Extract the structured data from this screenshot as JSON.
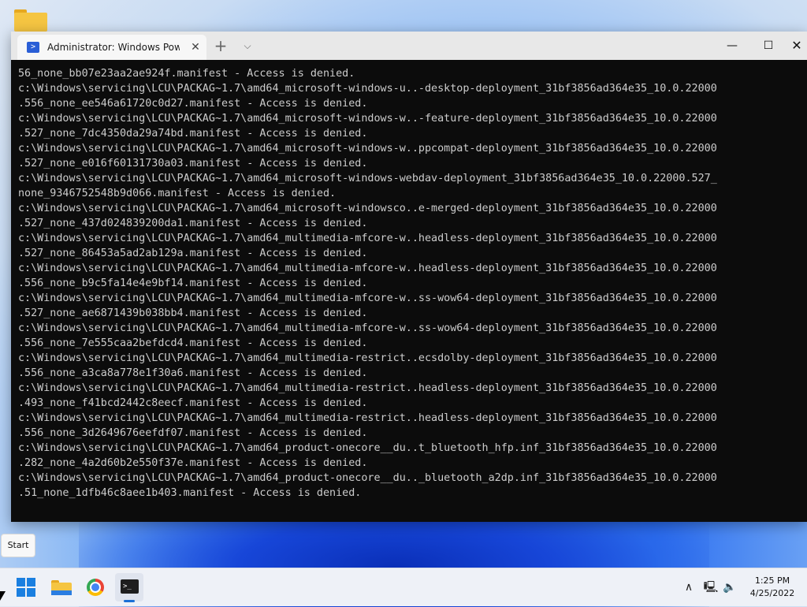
{
  "window": {
    "tab_title": "Administrator: Windows PowerShell",
    "new_tab": "+",
    "dropdown": "⌵",
    "minimize": "—",
    "maximize": "☐",
    "close": "✕"
  },
  "console_lines": [
    "56_none_bb07e23aa2ae924f.manifest - Access is denied.",
    "c:\\Windows\\servicing\\LCU\\PACKAG~1.7\\amd64_microsoft-windows-u..-desktop-deployment_31bf3856ad364e35_10.0.22000",
    ".556_none_ee546a61720c0d27.manifest - Access is denied.",
    "c:\\Windows\\servicing\\LCU\\PACKAG~1.7\\amd64_microsoft-windows-w..-feature-deployment_31bf3856ad364e35_10.0.22000",
    ".527_none_7dc4350da29a74bd.manifest - Access is denied.",
    "c:\\Windows\\servicing\\LCU\\PACKAG~1.7\\amd64_microsoft-windows-w..ppcompat-deployment_31bf3856ad364e35_10.0.22000",
    ".527_none_e016f60131730a03.manifest - Access is denied.",
    "c:\\Windows\\servicing\\LCU\\PACKAG~1.7\\amd64_microsoft-windows-webdav-deployment_31bf3856ad364e35_10.0.22000.527_",
    "none_9346752548b9d066.manifest - Access is denied.",
    "c:\\Windows\\servicing\\LCU\\PACKAG~1.7\\amd64_microsoft-windowsco..e-merged-deployment_31bf3856ad364e35_10.0.22000",
    ".527_none_437d024839200da1.manifest - Access is denied.",
    "c:\\Windows\\servicing\\LCU\\PACKAG~1.7\\amd64_multimedia-mfcore-w..headless-deployment_31bf3856ad364e35_10.0.22000",
    ".527_none_86453a5ad2ab129a.manifest - Access is denied.",
    "c:\\Windows\\servicing\\LCU\\PACKAG~1.7\\amd64_multimedia-mfcore-w..headless-deployment_31bf3856ad364e35_10.0.22000",
    ".556_none_b9c5fa14e4e9bf14.manifest - Access is denied.",
    "c:\\Windows\\servicing\\LCU\\PACKAG~1.7\\amd64_multimedia-mfcore-w..ss-wow64-deployment_31bf3856ad364e35_10.0.22000",
    ".527_none_ae6871439b038bb4.manifest - Access is denied.",
    "c:\\Windows\\servicing\\LCU\\PACKAG~1.7\\amd64_multimedia-mfcore-w..ss-wow64-deployment_31bf3856ad364e35_10.0.22000",
    ".556_none_7e555caa2befdcd4.manifest - Access is denied.",
    "c:\\Windows\\servicing\\LCU\\PACKAG~1.7\\amd64_multimedia-restrict..ecsdolby-deployment_31bf3856ad364e35_10.0.22000",
    ".556_none_a3ca8a778e1f30a6.manifest - Access is denied.",
    "c:\\Windows\\servicing\\LCU\\PACKAG~1.7\\amd64_multimedia-restrict..headless-deployment_31bf3856ad364e35_10.0.22000",
    ".493_none_f41bcd2442c8eecf.manifest - Access is denied.",
    "c:\\Windows\\servicing\\LCU\\PACKAG~1.7\\amd64_multimedia-restrict..headless-deployment_31bf3856ad364e35_10.0.22000",
    ".556_none_3d2649676eefdf07.manifest - Access is denied.",
    "c:\\Windows\\servicing\\LCU\\PACKAG~1.7\\amd64_product-onecore__du..t_bluetooth_hfp.inf_31bf3856ad364e35_10.0.22000",
    ".282_none_4a2d60b2e550f37e.manifest - Access is denied.",
    "c:\\Windows\\servicing\\LCU\\PACKAG~1.7\\amd64_product-onecore__du.._bluetooth_a2dp.inf_31bf3856ad364e35_10.0.22000",
    ".51_none_1dfb46c8aee1b403.manifest - Access is denied."
  ],
  "start_tooltip": "Start",
  "taskbar": {
    "apps": [
      "start-icon",
      "file-explorer-icon",
      "chrome-icon",
      "terminal-icon"
    ],
    "terminal_glyph": ">_",
    "tray_chevron": "∧",
    "network_glyph": "🖳",
    "volume_glyph": "🔈",
    "time": "1:25 PM",
    "date": "4/25/2022"
  }
}
